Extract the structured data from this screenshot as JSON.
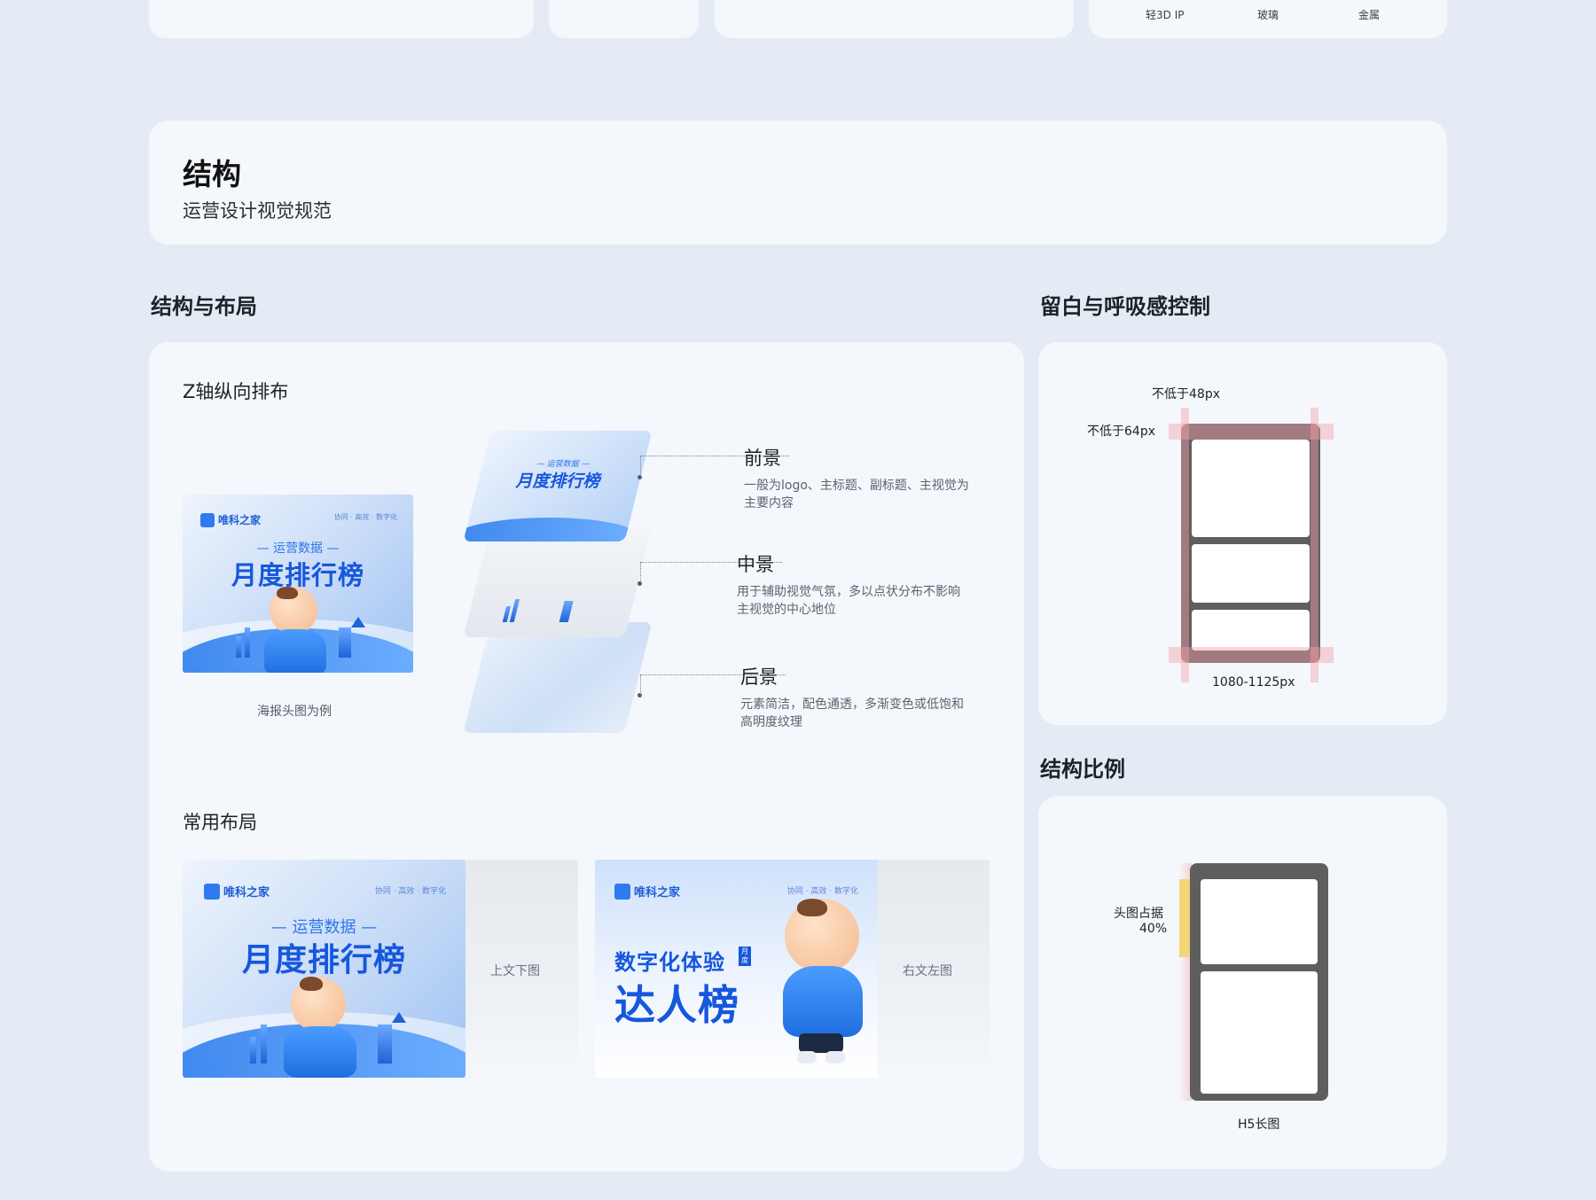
{
  "top_remnant": {
    "labels": [
      "轻3D IP",
      "玻璃",
      "金属"
    ]
  },
  "section": {
    "title": "结构",
    "subtitle": "运营设计视觉规范"
  },
  "structure_layout": {
    "heading": "结构与布局",
    "z_axis_title": "Z轴纵向排布",
    "example_caption": "海报头图为例",
    "layers": [
      {
        "title": "前景",
        "desc": "一般为logo、主标题、副标题、主视觉为主要内容"
      },
      {
        "title": "中景",
        "desc": "用于辅助视觉气氛，多以点状分布不影响主视觉的中心地位"
      },
      {
        "title": "后景",
        "desc": "元素简洁，配色通透，多渐变色或低饱和高明度纹理"
      }
    ],
    "common_layout_title": "常用布局",
    "layouts": [
      {
        "label": "上文下图"
      },
      {
        "label": "右文左图"
      }
    ]
  },
  "poster": {
    "brand": "唯科之家",
    "tagline": "协同 · 高效 · 数字化",
    "kicker": "— 运营数据 —",
    "headline": "月度排行榜",
    "alt_headline_1": "数字化体验",
    "alt_badge": "月度",
    "alt_headline_2": "达人榜"
  },
  "whitespace": {
    "heading": "留白与呼吸感控制",
    "top_margin": "不低于48px",
    "side_margin": "不低于64px",
    "width_label": "1080-1125px"
  },
  "ratio": {
    "heading": "结构比例",
    "head_label_1": "头图占据",
    "head_label_2": "40%",
    "bottom_label": "H5长图"
  },
  "colors": {
    "background": "#e4ebf4",
    "card": "#f4f7fb",
    "brand_blue": "#1657dd",
    "frame_gray": "#5e5e5e",
    "guide_pink": "#f5a0aa",
    "ratio_yellow": "#f3d477"
  }
}
